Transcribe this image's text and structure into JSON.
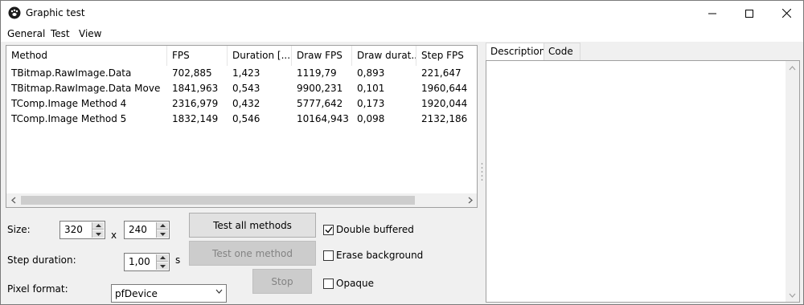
{
  "window": {
    "title": "Graphic test",
    "icon": "app-paw-icon"
  },
  "menu": [
    "General",
    "Test",
    "View"
  ],
  "grid": {
    "columns": [
      "Method",
      "FPS",
      "Duration [...",
      "Draw FPS",
      "Draw durat...",
      "Step FPS"
    ],
    "rows": [
      [
        "TBitmap.RawImage.Data",
        "702,885",
        "1,423",
        "1119,79",
        "0,893",
        "221,647"
      ],
      [
        "TBitmap.RawImage.Data Move",
        "1841,963",
        "0,543",
        "9900,231",
        "0,101",
        "1960,644"
      ],
      [
        "TComp.Image Method 4",
        "2316,979",
        "0,432",
        "5777,642",
        "0,173",
        "1920,044"
      ],
      [
        "TComp.Image Method 5",
        "1832,149",
        "0,546",
        "10164,943",
        "0,098",
        "2132,186"
      ]
    ]
  },
  "controls": {
    "size_label": "Size:",
    "width": "320",
    "x_label": "x",
    "height": "240",
    "step_label": "Step duration:",
    "step_value": "1,00",
    "step_unit": "s",
    "pixel_label": "Pixel format:",
    "pixel_value": "pfDevice",
    "btn_all": "Test all methods",
    "btn_one": "Test one method",
    "btn_stop": "Stop",
    "chk_double": "Double buffered",
    "chk_double_checked": true,
    "chk_erase": "Erase background",
    "chk_erase_checked": false,
    "chk_opaque": "Opaque",
    "chk_opaque_checked": false
  },
  "tabs": [
    "Description",
    "Code"
  ],
  "active_tab": "Description"
}
